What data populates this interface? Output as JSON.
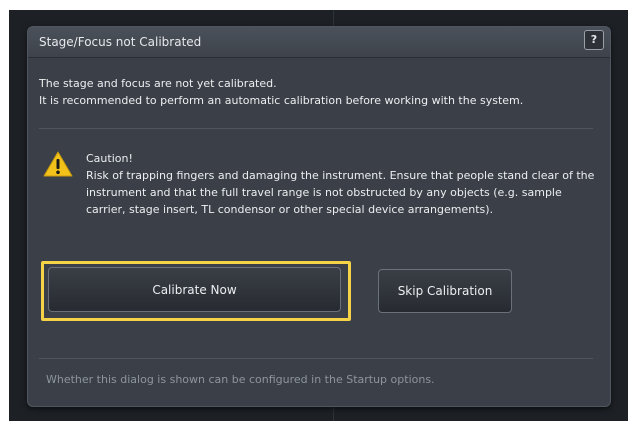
{
  "dialog": {
    "title": "Stage/Focus not Calibrated",
    "help_label": "?",
    "intro_lines": [
      "The stage and focus are not yet calibrated.",
      "It is recommended to perform an automatic calibration before working with the system."
    ],
    "caution_title": "Caution!",
    "caution_text": "Risk of trapping fingers and damaging the instrument. Ensure that people stand clear of the instrument and that the full travel range is not obstructed by any objects (e.g. sample carrier, stage insert, TL condensor or other special device arrangements).",
    "calibrate_label": "Calibrate Now",
    "skip_label": "Skip Calibration",
    "footer_text": "Whether this dialog is shown can be configured in the Startup options."
  },
  "colors": {
    "highlight": "#f5d247",
    "warning": "#f2c21b",
    "dialog_bg": "#3b4048"
  },
  "icons": {
    "warning": "warning-triangle-icon",
    "help": "help-icon"
  }
}
